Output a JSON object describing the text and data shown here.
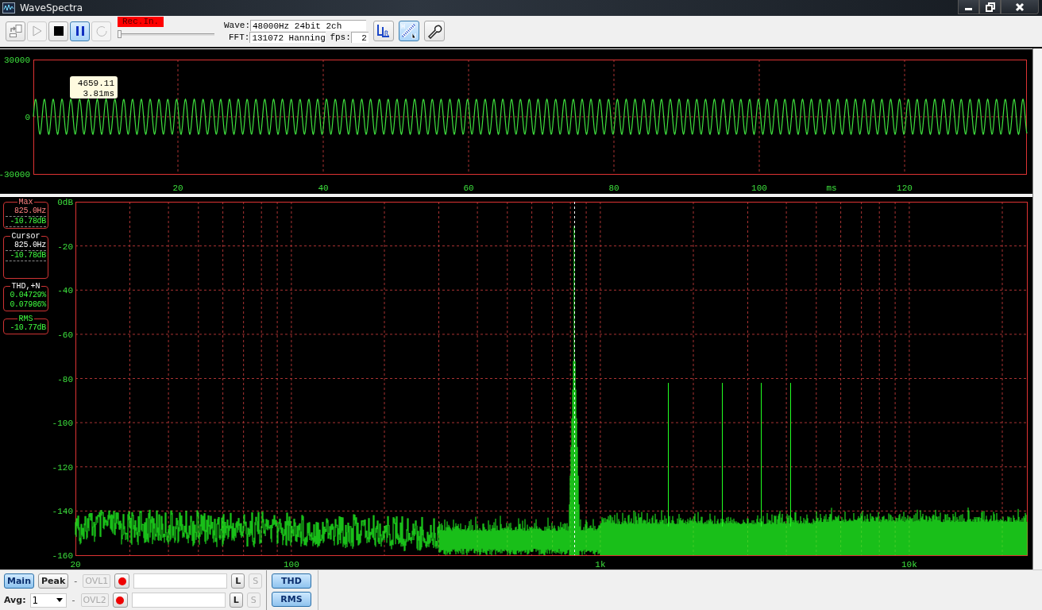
{
  "window": {
    "title": "WaveSpectra"
  },
  "toolbar": {
    "buttons": [
      {
        "kind": "export",
        "disabled": false,
        "active": false
      },
      {
        "kind": "play",
        "disabled": true,
        "active": false
      },
      {
        "kind": "stop",
        "disabled": false,
        "active": false
      },
      {
        "kind": "pause",
        "disabled": false,
        "active": true
      },
      {
        "kind": "loop",
        "disabled": true,
        "active": false
      }
    ],
    "input": {
      "label": "Rec.In.",
      "level": 0
    },
    "wave_label": "Wave:",
    "wave_value": "48000Hz 24bit 2ch",
    "fft_label": "FFT:",
    "fft_value": "131072 Hanning",
    "fps_label": "fps:",
    "fps_value": "2",
    "view_buttons": [
      {
        "kind": "channels",
        "active": false
      },
      {
        "kind": "units",
        "active": true
      },
      {
        "kind": "settings",
        "active": false
      }
    ]
  },
  "waveform": {
    "y_ticks": [
      "30000",
      "0",
      "-30000"
    ],
    "x_ticks": [
      "20",
      "40",
      "60",
      "80",
      "100",
      "120"
    ],
    "x_unit": "ms",
    "tooltip": {
      "value": "4659.11",
      "time": "3.81ms"
    }
  },
  "spectrum": {
    "readouts": [
      {
        "kind": "max",
        "title": "Max",
        "lines": [
          {
            "text": "825.0Hz",
            "kind": "freq_field"
          },
          {
            "text": "-10.78dB",
            "kind": "level_field"
          }
        ]
      },
      {
        "kind": "cursor",
        "title": "Cursor",
        "lines": [
          {
            "text": "825.0Hz",
            "kind": "freq_field"
          },
          {
            "text": "-10.78dB",
            "kind": "level_field"
          }
        ]
      },
      {
        "kind": "thd",
        "title": "THD,+N",
        "lines": [
          {
            "text": "0.04729%",
            "kind": "value"
          },
          {
            "text": "0.07986%",
            "kind": "value"
          }
        ]
      },
      {
        "kind": "rms",
        "title": "RMS",
        "lines": [
          {
            "text": "-10.77dB",
            "kind": "value"
          }
        ]
      }
    ],
    "y_ticks": [
      "0dB",
      "-20",
      "-40",
      "-60",
      "-80",
      "-100",
      "-120",
      "-140",
      "-160"
    ],
    "x_ticks": [
      "20",
      "100",
      "1k",
      "10k"
    ]
  },
  "bottom_bar": {
    "modes": [
      {
        "label": "Main",
        "selected": true
      },
      {
        "label": "Peak",
        "selected": false
      }
    ],
    "avg_label": "Avg:",
    "avg_value": "1",
    "channels": [
      {
        "dash": "-",
        "overload": "OVL1",
        "overload_lit": false,
        "link": "L",
        "solo": "S",
        "solo_enabled": false
      },
      {
        "dash": "-",
        "overload": "OVL2",
        "overload_lit": false,
        "link": "L",
        "solo": "S",
        "solo_enabled": false
      }
    ],
    "toggles": [
      {
        "label": "THD",
        "on": true
      },
      {
        "label": "RMS",
        "on": true
      }
    ]
  }
}
